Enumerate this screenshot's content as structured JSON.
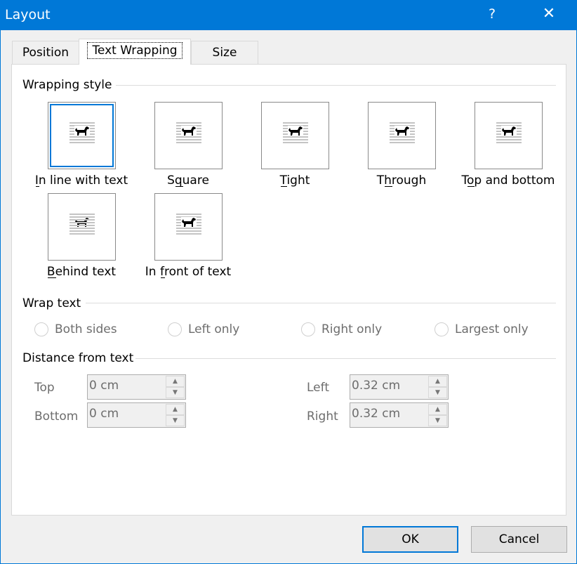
{
  "window": {
    "title": "Layout",
    "help_glyph": "?",
    "close_glyph": "✕"
  },
  "tabs": [
    {
      "label": "Position",
      "selected": false
    },
    {
      "label": "Text Wrapping",
      "selected": true
    },
    {
      "label": "Size",
      "selected": false
    }
  ],
  "wrapping_style": {
    "heading": "Wrapping style",
    "options": [
      {
        "label": "In line with text",
        "mnemonic": "I",
        "icon": "inline-dog-icon",
        "selected": true
      },
      {
        "label": "Square",
        "mnemonic": "q",
        "icon": "square-dog-icon",
        "selected": false
      },
      {
        "label": "Tight",
        "mnemonic": "T",
        "icon": "tight-dog-icon",
        "selected": false
      },
      {
        "label": "Through",
        "mnemonic": "h",
        "icon": "through-dog-icon",
        "selected": false
      },
      {
        "label": "Top and bottom",
        "mnemonic": "o",
        "icon": "top-bottom-dog-icon",
        "selected": false
      },
      {
        "label": "Behind text",
        "mnemonic": "B",
        "icon": "behind-dog-icon",
        "selected": false
      },
      {
        "label": "In front of text",
        "mnemonic": "f",
        "icon": "front-dog-icon",
        "selected": false
      }
    ]
  },
  "wrap_text": {
    "heading": "Wrap text",
    "options": [
      {
        "label": "Both sides"
      },
      {
        "label": "Left only"
      },
      {
        "label": "Right only"
      },
      {
        "label": "Largest only"
      }
    ],
    "enabled": false
  },
  "distance": {
    "heading": "Distance from text",
    "top": {
      "label": "Top",
      "value": "0 cm"
    },
    "bottom": {
      "label": "Bottom",
      "value": "0 cm"
    },
    "left": {
      "label": "Left",
      "value": "0.32 cm"
    },
    "right": {
      "label": "Right",
      "value": "0.32 cm"
    }
  },
  "buttons": {
    "ok": "OK",
    "cancel": "Cancel"
  },
  "colors": {
    "accent": "#0078d7"
  }
}
